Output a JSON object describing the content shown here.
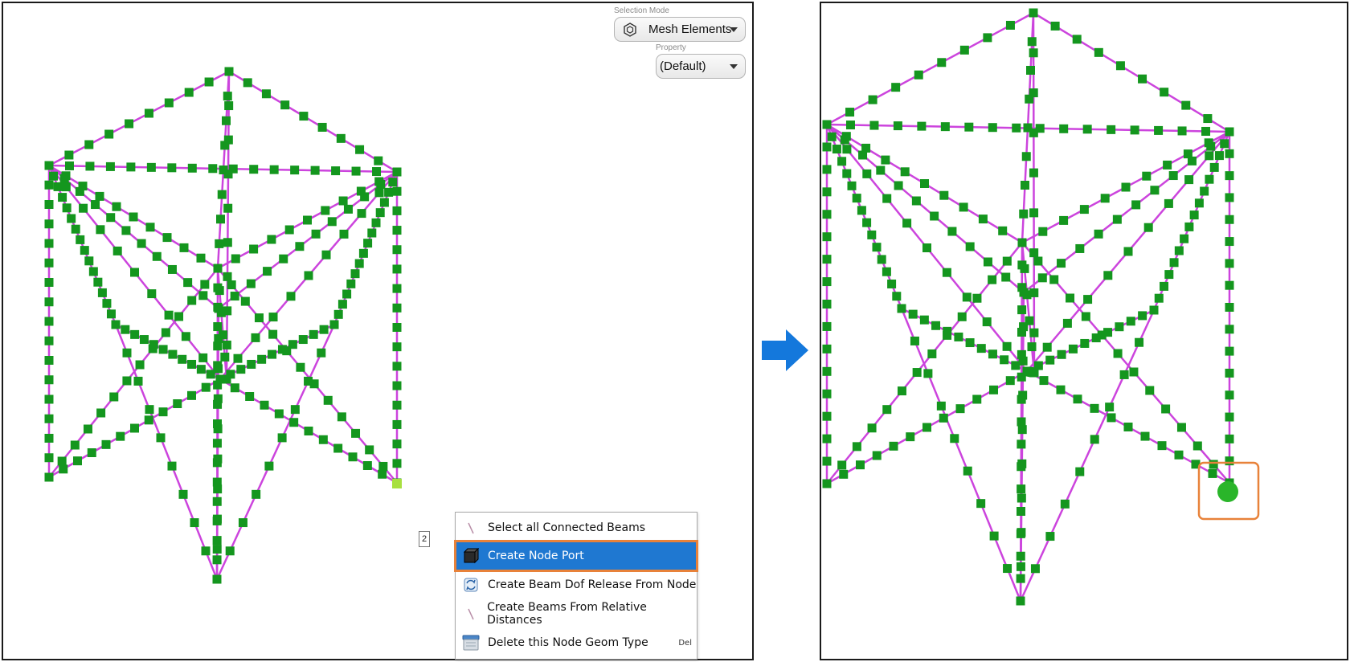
{
  "toolbar": {
    "selection_mode_label": "Selection Mode",
    "selection_mode_value": "Mesh Elements",
    "property_label": "Property",
    "property_value": "(Default)"
  },
  "viewport": {
    "node_badge": "2"
  },
  "context_menu": {
    "items": [
      {
        "label": "Select all Connected Beams",
        "icon": "beam-line-icon",
        "shortcut": ""
      },
      {
        "label": "Create Node Port",
        "icon": "node-port-cube-icon",
        "shortcut": "",
        "selected": true
      },
      {
        "label": "Create Beam Dof Release From Node",
        "icon": "dof-release-icon",
        "shortcut": ""
      },
      {
        "label": "Create Beams From Relative Distances",
        "icon": "beam-line-icon",
        "shortcut": ""
      },
      {
        "label": "Delete this Node Geom Type",
        "icon": "delete-geom-icon",
        "shortcut": "Del"
      }
    ]
  },
  "colors": {
    "beam": "#cc44dd",
    "node": "#14961e",
    "selected_node": "#a8e040",
    "highlight": "#e8823a",
    "menu_selected": "#1f78d1",
    "arrow": "#1478dc",
    "port": "#2ab52a"
  }
}
